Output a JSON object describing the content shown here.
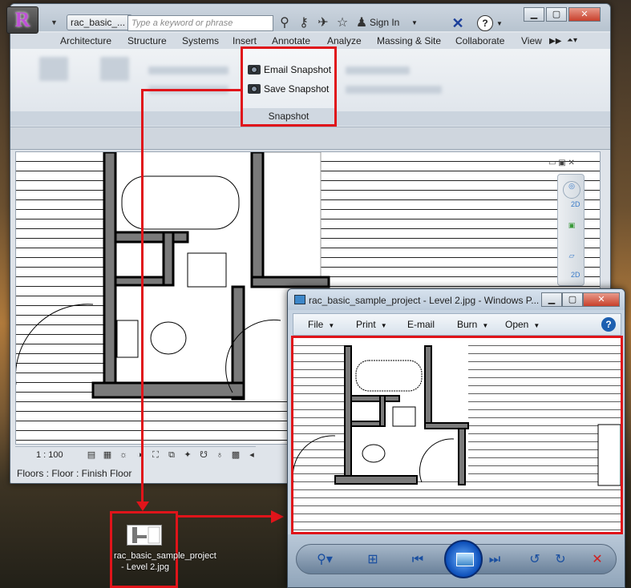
{
  "revit": {
    "doc_tab": "rac_basic_...",
    "search_placeholder": "Type a keyword or phrase",
    "sign_in": "Sign In",
    "menu": [
      "Architecture",
      "Structure",
      "Systems",
      "Insert",
      "Annotate",
      "Analyze",
      "Massing & Site",
      "Collaborate",
      "View"
    ],
    "snapshot": {
      "email": "Email Snapshot",
      "save": "Save Snapshot",
      "panel_label": "Snapshot"
    },
    "scale": "1 : 100",
    "status": "Floors : Floor : Finish Floor",
    "nav_2d_a": "2D",
    "nav_2d_b": "2D"
  },
  "file_icon": {
    "name": "rac_basic_sample_project - Level 2.jpg"
  },
  "viewer": {
    "title": "rac_basic_sample_project - Level 2.jpg - Windows P...",
    "menu": [
      "File",
      "Print",
      "E-mail",
      "Burn",
      "Open"
    ]
  },
  "colors": {
    "highlight_red": "#e0141a",
    "wall_gray": "#7a7a7a"
  }
}
